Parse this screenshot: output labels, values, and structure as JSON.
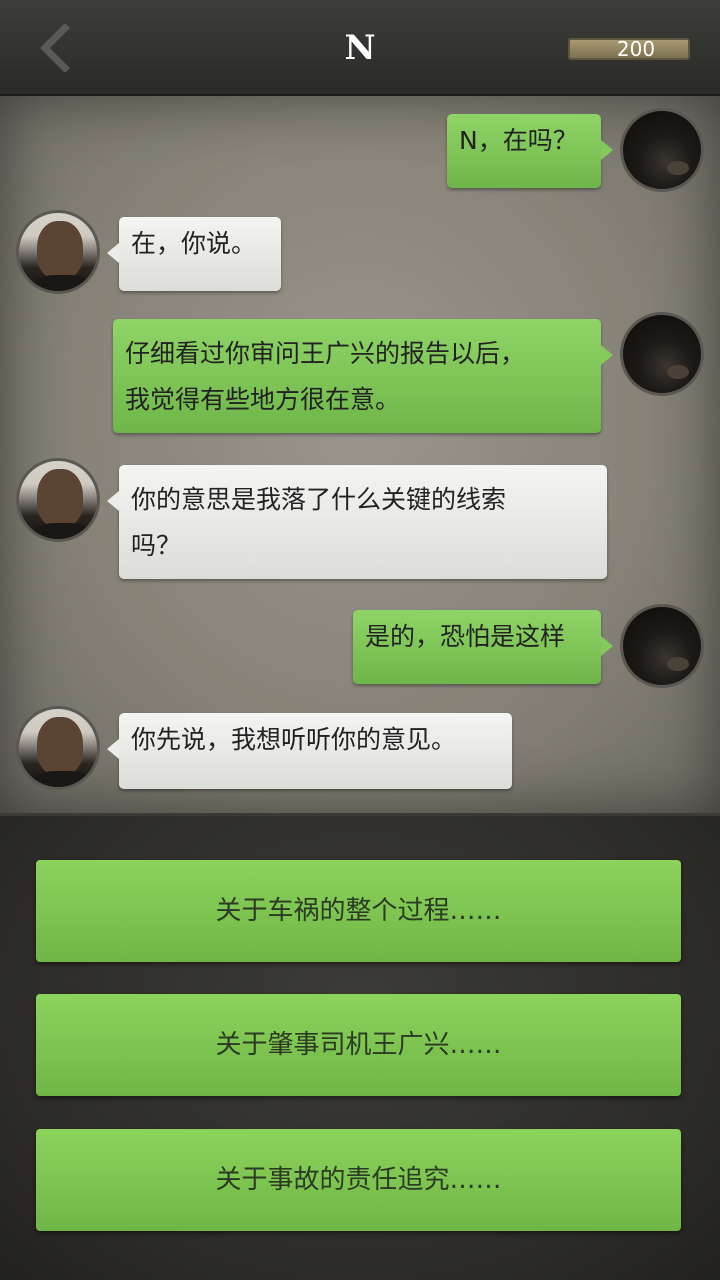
{
  "header": {
    "title": "N",
    "coins": "200"
  },
  "messages": [
    {
      "sender": "me",
      "text": "N，在吗？"
    },
    {
      "sender": "them",
      "text": "在，你说。"
    },
    {
      "sender": "me",
      "lines": [
        "仔细看过你审问王广兴的报告以后，",
        "我觉得有些地方很在意。"
      ]
    },
    {
      "sender": "them",
      "lines": [
        "你的意思是我落了什么关键的线索",
        "吗？"
      ]
    },
    {
      "sender": "me",
      "text": "是的，恐怕是这样"
    },
    {
      "sender": "them",
      "text": "你先说，我想听听你的意见。"
    }
  ],
  "options": [
    "关于车祸的整个过程……",
    "关于肇事司机王广兴……",
    "关于事故的责任追究……"
  ],
  "colors": {
    "my_bubble": "#7fc456",
    "their_bubble": "#eaeae7",
    "option_button": "#7cc552"
  },
  "icons": {
    "back": "chevron-left-icon"
  }
}
